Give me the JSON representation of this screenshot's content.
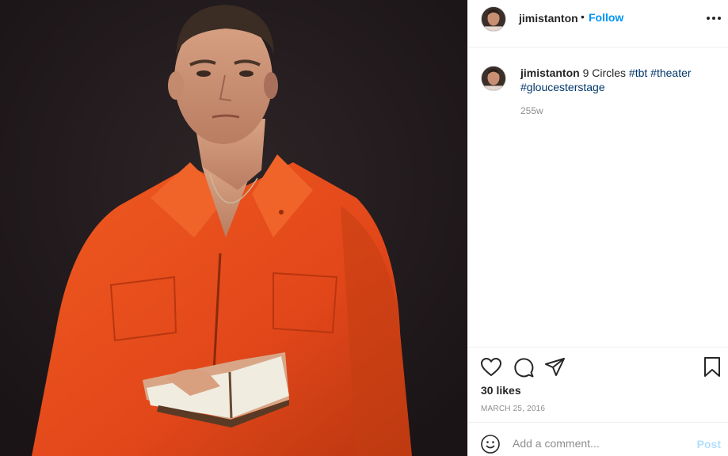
{
  "header": {
    "username": "jimistanton",
    "separator": "•",
    "follow_label": "Follow",
    "more_icon": "more-horizontal-icon"
  },
  "caption": {
    "username": "jimistanton",
    "text": "9 Circles",
    "hashtags": [
      "#tbt",
      "#theater",
      "#gloucesterstage"
    ],
    "age": "255w"
  },
  "actions": {
    "icons": [
      "heart-icon",
      "comment-icon",
      "share-icon",
      "bookmark-icon"
    ],
    "likes": "30 likes",
    "date": "MARCH 25, 2016"
  },
  "comment": {
    "placeholder": "Add a comment...",
    "post_label": "Post",
    "emoji_icon": "emoji-icon"
  },
  "colors": {
    "accent": "#0095f6",
    "hashtag": "#00376b",
    "muted": "#8e8e8e",
    "post_disabled": "#b2dffc",
    "jumpsuit": "#e8531c"
  }
}
